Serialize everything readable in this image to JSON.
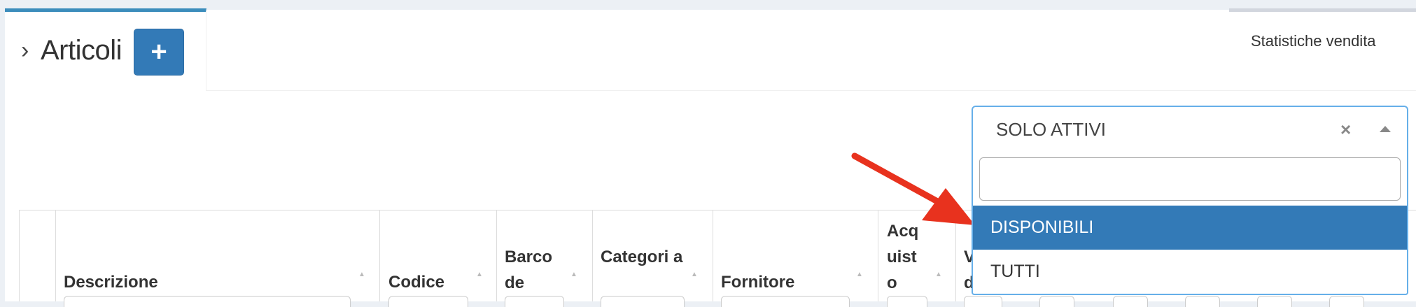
{
  "header": {
    "title": "Articoli",
    "add_button_label": "+",
    "stats_link": "Statistiche vendita"
  },
  "filter_select": {
    "selected": "SOLO ATTIVI",
    "clear_symbol": "×",
    "search_value": "",
    "options": [
      {
        "label": "DISPONIBILI",
        "highlighted": true
      },
      {
        "label": "TUTTI",
        "highlighted": false
      }
    ]
  },
  "table": {
    "columns": [
      {
        "label": ""
      },
      {
        "label": "Descrizione"
      },
      {
        "label": "Codice"
      },
      {
        "label": "Barco de"
      },
      {
        "label": "Categori a"
      },
      {
        "label": "Fornitore"
      },
      {
        "label": "Acq uist o"
      },
      {
        "label": "V d"
      }
    ]
  },
  "colors": {
    "primary": "#337ab7",
    "tab_active_border": "#3c8dbc",
    "arrow": "#e8321e"
  }
}
